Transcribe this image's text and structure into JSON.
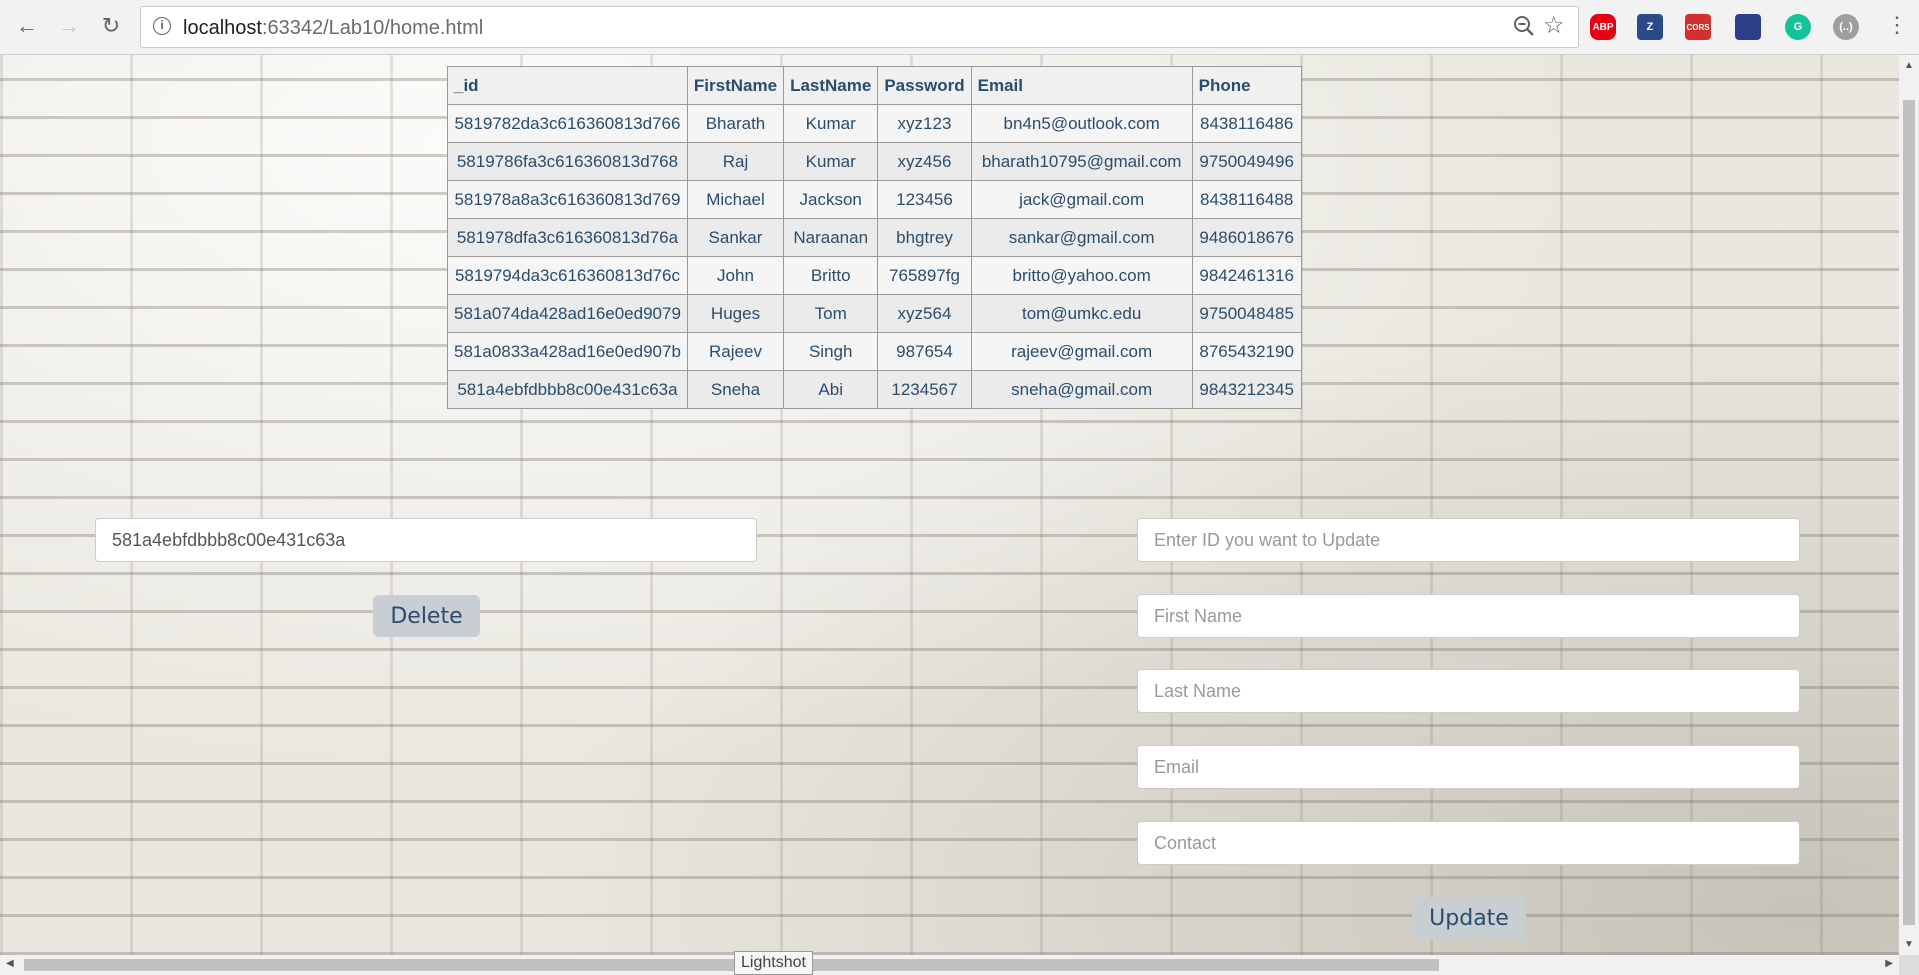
{
  "browser": {
    "url_host": "localhost",
    "url_path": ":63342/Lab10/home.html",
    "extensions": [
      {
        "name": "adblock-plus-icon",
        "label": "ABP",
        "color": "#e60012"
      },
      {
        "name": "zotero-icon",
        "label": "Z",
        "color": "#2a4a8a"
      },
      {
        "name": "cors-icon",
        "label": "CORS",
        "color": "#d32f2f"
      },
      {
        "name": "screenshot-ext-icon",
        "label": "",
        "color": "#2d3e8a"
      },
      {
        "name": "grammarly-icon",
        "label": "G",
        "color": "#15c39a"
      },
      {
        "name": "json-viewer-icon",
        "label": "(..)",
        "color": "#9e9e9e"
      }
    ]
  },
  "table": {
    "headers": [
      "_id",
      "FirstName",
      "LastName",
      "Password",
      "Email",
      "Phone"
    ],
    "rows": [
      [
        "5819782da3c616360813d766",
        "Bharath",
        "Kumar",
        "xyz123",
        "bn4n5@outlook.com",
        "8438116486"
      ],
      [
        "5819786fa3c616360813d768",
        "Raj",
        "Kumar",
        "xyz456",
        "bharath10795@gmail.com",
        "9750049496"
      ],
      [
        "581978a8a3c616360813d769",
        "Michael",
        "Jackson",
        "123456",
        "jack@gmail.com",
        "8438116488"
      ],
      [
        "581978dfa3c616360813d76a",
        "Sankar",
        "Naraanan",
        "bhgtrey",
        "sankar@gmail.com",
        "9486018676"
      ],
      [
        "5819794da3c616360813d76c",
        "John",
        "Britto",
        "765897fg",
        "britto@yahoo.com",
        "9842461316"
      ],
      [
        "581a074da428ad16e0ed9079",
        "Huges",
        "Tom",
        "xyz564",
        "tom@umkc.edu",
        "9750048485"
      ],
      [
        "581a0833a428ad16e0ed907b",
        "Rajeev",
        "Singh",
        "987654",
        "rajeev@gmail.com",
        "8765432190"
      ],
      [
        "581a4ebfdbbb8c00e431c63a",
        "Sneha",
        "Abi",
        "1234567",
        "sneha@gmail.com",
        "9843212345"
      ]
    ]
  },
  "delete_form": {
    "id_value": "581a4ebfdbbb8c00e431c63a",
    "button_label": "Delete"
  },
  "update_form": {
    "id_placeholder": "Enter ID you want to Update",
    "first_name_placeholder": "First Name",
    "last_name_placeholder": "Last Name",
    "email_placeholder": "Email",
    "contact_placeholder": "Contact",
    "button_label": "Update"
  },
  "tooltip": "Lightshot"
}
